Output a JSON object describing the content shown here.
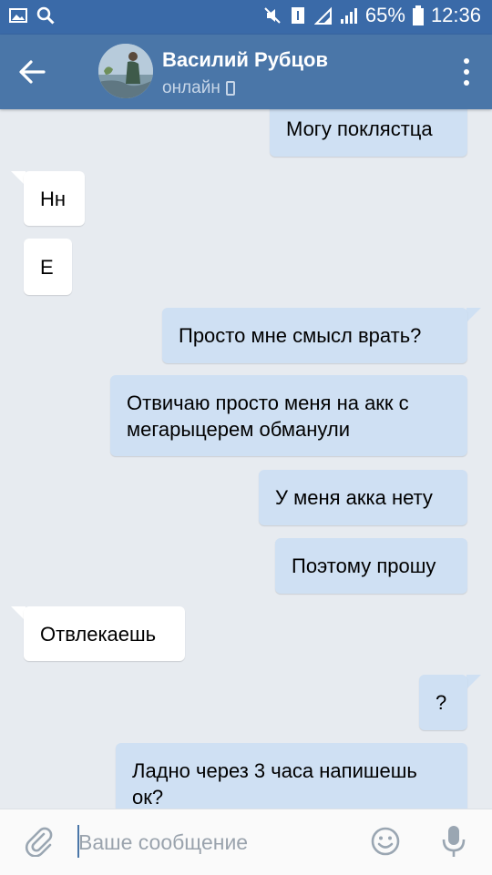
{
  "status_bar": {
    "battery": "65%",
    "time": "12:36"
  },
  "header": {
    "name": "Василий Рубцов",
    "presence": "онлайн"
  },
  "messages": [
    {
      "dir": "out",
      "text": "Могу поклястца"
    },
    {
      "dir": "in",
      "text": "Нн"
    },
    {
      "dir": "in",
      "text": "Е"
    },
    {
      "dir": "out",
      "text": "Просто мне смысл врать?"
    },
    {
      "dir": "out",
      "lines": [
        "Отвичаю просто меня на акк с",
        "мегарыцерем обманули"
      ]
    },
    {
      "dir": "out",
      "text": "У меня акка нету"
    },
    {
      "dir": "out",
      "text": "Поэтому прошу"
    },
    {
      "dir": "in",
      "text": "Отвлекаешь"
    },
    {
      "dir": "out",
      "text": "?"
    },
    {
      "dir": "out",
      "lines": [
        "Ладно через 3 часа напишешь",
        "ок?"
      ]
    }
  ],
  "composer": {
    "placeholder": "Ваше сообщение"
  },
  "colors": {
    "header": "#4a76a8",
    "status_bar": "#3a6aa8",
    "outgoing_bubble": "#cfe0f3",
    "incoming_bubble": "#ffffff",
    "background": "#e7ebf0"
  }
}
